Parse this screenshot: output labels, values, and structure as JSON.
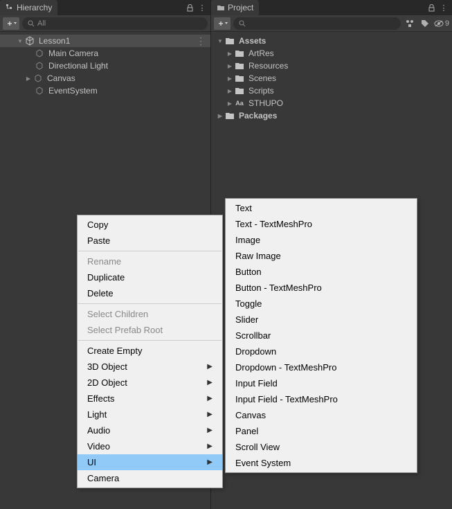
{
  "hierarchy": {
    "tab_label": "Hierarchy",
    "search_text": "All",
    "scene": "Lesson1",
    "objects": [
      "Main Camera",
      "Directional Light",
      "Canvas",
      "EventSystem"
    ]
  },
  "project": {
    "tab_label": "Project",
    "hidden_count": "9",
    "root": "Assets",
    "folders": [
      "ArtRes",
      "Resources",
      "Scenes",
      "Scripts"
    ],
    "font_item": "STHUPO",
    "packages": "Packages"
  },
  "context_menu": {
    "copy": "Copy",
    "paste": "Paste",
    "rename": "Rename",
    "duplicate": "Duplicate",
    "delete": "Delete",
    "select_children": "Select Children",
    "select_prefab_root": "Select Prefab Root",
    "create_empty": "Create Empty",
    "object_3d": "3D Object",
    "object_2d": "2D Object",
    "effects": "Effects",
    "light": "Light",
    "audio": "Audio",
    "video": "Video",
    "ui": "UI",
    "camera": "Camera"
  },
  "ui_submenu": {
    "items": [
      "Text",
      "Text - TextMeshPro",
      "Image",
      "Raw Image",
      "Button",
      "Button - TextMeshPro",
      "Toggle",
      "Slider",
      "Scrollbar",
      "Dropdown",
      "Dropdown - TextMeshPro",
      "Input Field",
      "Input Field - TextMeshPro",
      "Canvas",
      "Panel",
      "Scroll View",
      "Event System"
    ]
  }
}
